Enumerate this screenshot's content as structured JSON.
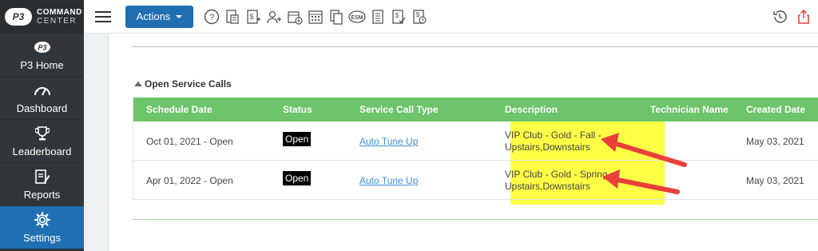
{
  "brand": {
    "badge": "P3",
    "line1": "COMMAND",
    "line2": "CENTER"
  },
  "sidebar": {
    "items": [
      {
        "label": "P3 Home",
        "icon": "p3-home-icon"
      },
      {
        "label": "Dashboard",
        "icon": "gauge-icon"
      },
      {
        "label": "Leaderboard",
        "icon": "trophy-icon"
      },
      {
        "label": "Reports",
        "icon": "report-edit-icon"
      },
      {
        "label": "Settings",
        "icon": "gear-icon",
        "active": true
      }
    ]
  },
  "toolbar": {
    "actions_label": "Actions",
    "icons": [
      "help-icon",
      "calculator-doc-icon",
      "add-invoice-icon",
      "add-user-icon",
      "add-schedule-icon",
      "calendar-icon",
      "copy-docs-icon",
      "esm-icon",
      "list-doc-icon",
      "approved-doc-icon",
      "doc-clock-icon"
    ],
    "esm_text": "ESM",
    "right_icons": [
      "history-icon",
      "export-icon"
    ]
  },
  "section": {
    "title": "Open Service Calls"
  },
  "table": {
    "headers": [
      "Schedule Date",
      "Status",
      "Service Call Type",
      "Description",
      "Technician Name",
      "Created Date"
    ],
    "rows": [
      {
        "schedule": "Oct 01, 2021 - Open",
        "status": "Open",
        "type": "Auto Tune Up",
        "desc1": "VIP Club - Gold - Fall -",
        "desc2": "Upstairs,Downstairs",
        "tech": "",
        "created": "May 03, 2021"
      },
      {
        "schedule": "Apr 01, 2022 - Open",
        "status": "Open",
        "type": "Auto Tune Up",
        "desc1": "VIP Club - Gold - Spring",
        "desc2": "Upstairs,Downstairs",
        "tech": "",
        "created": "May 03, 2021"
      }
    ]
  },
  "colors": {
    "sidebar": "#333638",
    "active": "#1f6fb2",
    "header_green": "#6dc46a",
    "highlight": "#ffff45",
    "arrow": "#e8403a"
  }
}
